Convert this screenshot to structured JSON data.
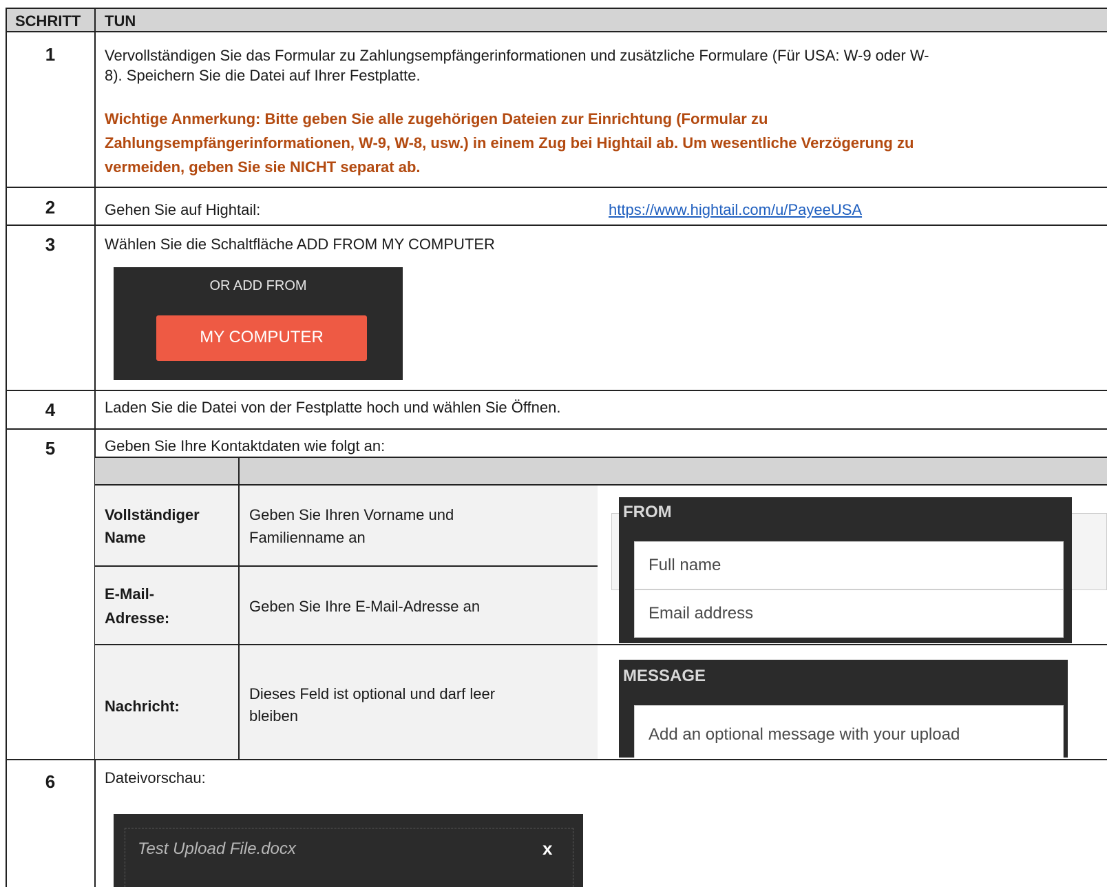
{
  "header": {
    "step_col": "SCHRITT",
    "action_col": "TUN"
  },
  "steps": [
    {
      "number": "1",
      "text_line1": "Vervollständigen Sie das Formular zu Zahlungsempfängerinformationen und zusätzliche Formulare (Für USA: W-9 oder W-",
      "text_line2": "8).  Speichern Sie die Datei auf Ihrer Festplatte.",
      "note_line1": "Wichtige Anmerkung: Bitte geben Sie alle zugehörigen Dateien zur Einrichtung (Formular zu",
      "note_line2": "Zahlungsempfängerinformationen, W-9, W-8, usw.) in einem Zug bei Hightail ab.  Um wesentliche Verzögerung zu",
      "note_line3": "vermeiden, geben Sie sie NICHT separat ab."
    },
    {
      "number": "2",
      "text": "Gehen Sie auf Hightail:",
      "link": "https://www.hightail.com/u/PayeeUSA"
    },
    {
      "number": "3",
      "text": "Wählen Sie die Schaltfläche ADD FROM MY COMPUTER",
      "widget_caption": "OR ADD FROM",
      "widget_button": "MY COMPUTER"
    },
    {
      "number": "4",
      "text": "Laden Sie die Datei von der Festplatte hoch und wählen Sie Öffnen."
    },
    {
      "number": "5",
      "text": "Geben Sie Ihre Kontaktdaten wie folgt an:",
      "rows": [
        {
          "label_line1": "Vollständiger",
          "label_line2": "Name",
          "desc_line1": "Geben Sie Ihren Vorname und",
          "desc_line2": "Familienname an"
        },
        {
          "label_line1": "E-Mail-",
          "label_line2": "Adresse:",
          "desc_line1": "Geben Sie Ihre E-Mail-Adresse an"
        },
        {
          "label_line1": "Nachricht:",
          "desc_line1": "Dieses Feld ist optional und darf leer",
          "desc_line2": "bleiben"
        }
      ],
      "from_widget": {
        "title": "FROM",
        "name_placeholder": "Full name",
        "email_placeholder": "Email address"
      },
      "message_widget": {
        "title": "MESSAGE",
        "placeholder": "Add an optional message with your upload"
      }
    },
    {
      "number": "6",
      "text": "Dateivorschau:",
      "file_name": "Test Upload File.docx",
      "remove_label": "x"
    }
  ]
}
